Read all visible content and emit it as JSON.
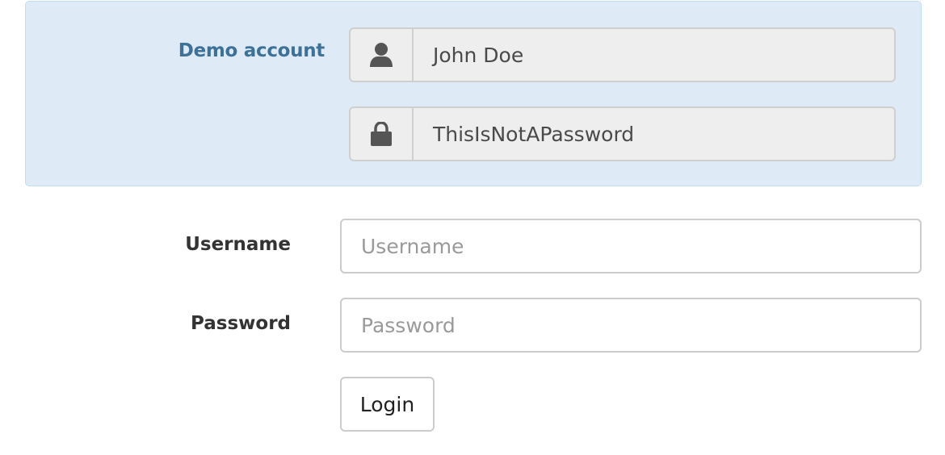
{
  "demo": {
    "label": "Demo account",
    "username_icon": "user-icon",
    "username_value": "John Doe",
    "password_icon": "lock-icon",
    "password_value": "ThisIsNotAPassword",
    "background_color": "#deebf6",
    "label_color": "#3d7198"
  },
  "form": {
    "username_label": "Username",
    "username_placeholder": "Username",
    "password_label": "Password",
    "password_placeholder": "Password",
    "login_label": "Login"
  }
}
